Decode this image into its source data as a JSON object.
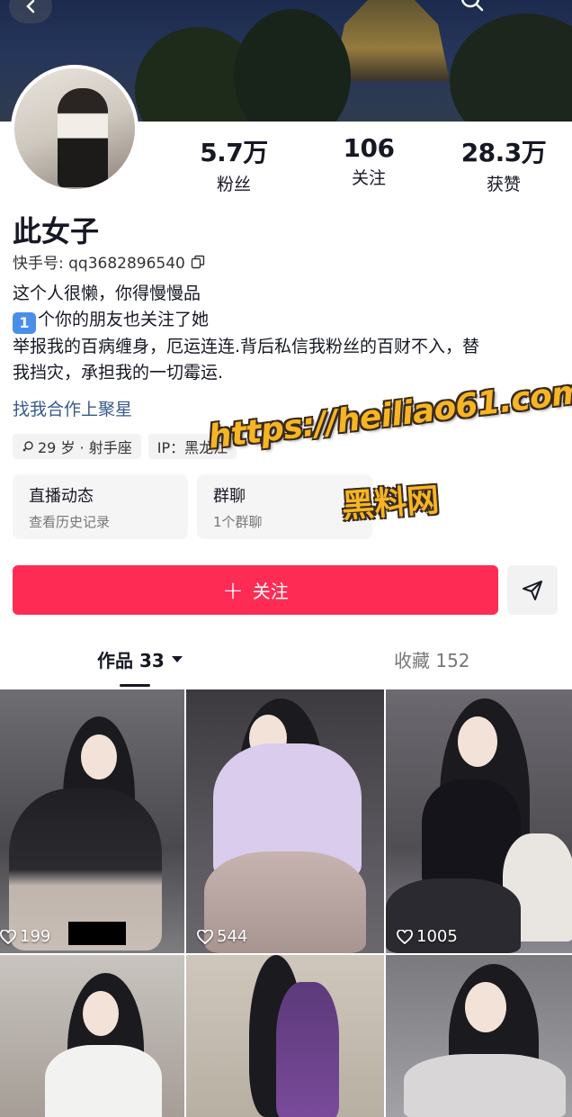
{
  "profile": {
    "name": "此女子",
    "id_label": "快手号: qq3682896540",
    "stats": [
      {
        "value": "5.7万",
        "label": "粉丝"
      },
      {
        "value": "106",
        "label": "关注"
      },
      {
        "value": "28.3万",
        "label": "获赞"
      }
    ],
    "bio_lines": [
      "这个人很懒，你得慢慢品",
      "个你的朋友也关注了她",
      "举报我的百病缠身，厄运连连.背后私信我粉丝的百财不入，替",
      "我挡灾，承担我的一切霉运."
    ],
    "bio_badge": "1",
    "cooperate_link": "找我合作上聚星",
    "tags": [
      "29 岁 · 射手座",
      "IP：黑龙江"
    ]
  },
  "cards": [
    {
      "title": "直播动态",
      "subtitle": "查看历史记录"
    },
    {
      "title": "群聊",
      "subtitle": "1个群聊"
    }
  ],
  "watermark": {
    "url": "https://heiliao61.com",
    "text": "黑料网"
  },
  "actions": {
    "follow_label": "关注"
  },
  "tabs": {
    "works": "作品 33",
    "favorites": "收藏 152"
  },
  "videos": [
    {
      "likes": "199"
    },
    {
      "likes": "544"
    },
    {
      "likes": "1005"
    },
    {
      "likes": ""
    },
    {
      "likes": ""
    },
    {
      "likes": ""
    }
  ],
  "colors": {
    "accent": "#fe2c55",
    "link": "#385a8c",
    "watermark": "#f5b524"
  }
}
